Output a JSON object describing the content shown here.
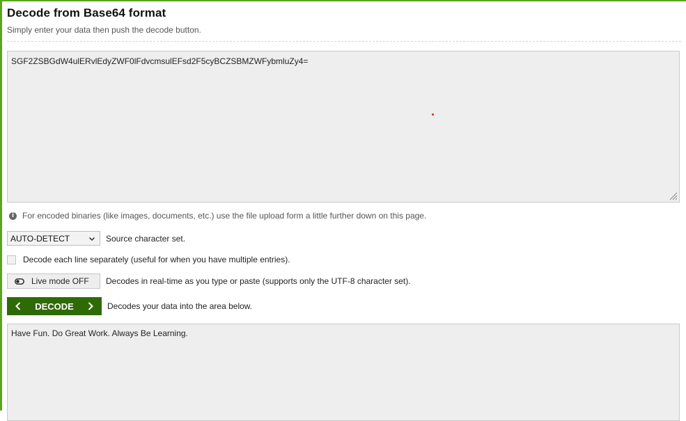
{
  "header": {
    "title": "Decode from Base64 format",
    "subtitle": "Simply enter your data then push the decode button."
  },
  "input": {
    "value": "SGF2ZSBGdW4ulERvlEdyZWF0lFdvcmsulEFsd2F5cyBCZSBMZWFybmluZy4="
  },
  "info": {
    "text": "For encoded binaries (like images, documents, etc.) use the file upload form a little further down on this page."
  },
  "charset": {
    "selected": "AUTO-DETECT",
    "label": "Source character set."
  },
  "line_option": {
    "label": "Decode each line separately (useful for when you have multiple entries)."
  },
  "live_mode": {
    "button_label": "Live mode OFF",
    "description": "Decodes in real-time as you type or paste (supports only the UTF-8 character set)."
  },
  "decode": {
    "button_label": "DECODE",
    "description": "Decodes your data into the area below."
  },
  "output": {
    "value": "Have Fun. Do Great Work. Always Be Learning."
  },
  "colors": {
    "accent_green": "#2e6a06",
    "frame_green": "#5aa51e",
    "field_bg": "#eeeeee"
  },
  "icons": [
    "info-icon",
    "chevron-down-icon",
    "toggle-icon",
    "chevron-left-icon",
    "chevron-right-icon",
    "resize-grip-icon"
  ]
}
